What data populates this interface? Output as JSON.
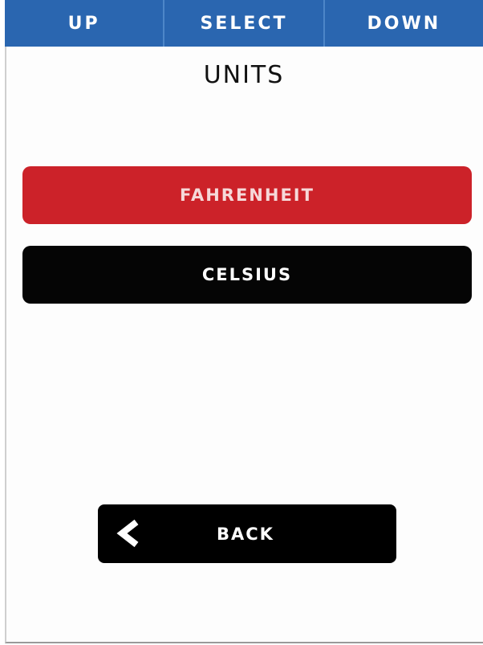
{
  "nav": {
    "up": "UP",
    "select": "SELECT",
    "down": "DOWN"
  },
  "page": {
    "title": "UNITS"
  },
  "options": [
    {
      "label": "FAHRENHEIT",
      "selected": true
    },
    {
      "label": "CELSIUS",
      "selected": false
    }
  ],
  "back": {
    "icon": "chevron-left-icon",
    "label": "BACK"
  },
  "colors": {
    "nav_bar": "#2a66b0",
    "selected_option": "#cc2229",
    "option": "#050505",
    "back_button": "#000000"
  }
}
